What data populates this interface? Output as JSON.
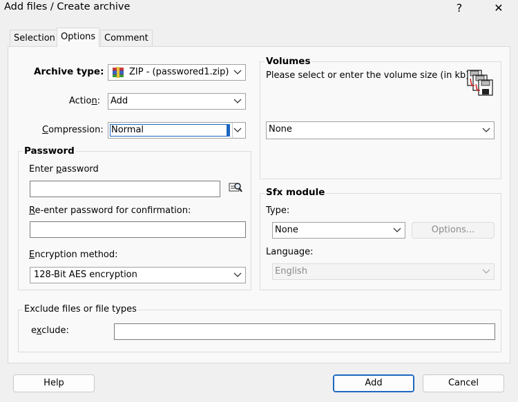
{
  "window": {
    "title": "Add files / Create archive",
    "help_glyph": "?",
    "close_glyph": "✕"
  },
  "tabs": [
    {
      "label": "Selection",
      "active": false
    },
    {
      "label": "Options",
      "active": true
    },
    {
      "label": "Comment",
      "active": false
    }
  ],
  "archive": {
    "type_label": "Archive type:",
    "type_value": "ZIP - (passwored1.zip)",
    "action_label_a": "Actio",
    "action_label_u": "n",
    "action_label_b": ":",
    "action_value": "Add",
    "compression_label_u": "C",
    "compression_label_b": "ompression:",
    "compression_value": "Normal"
  },
  "password": {
    "group_label": "Password",
    "enter_label_a": "Enter ",
    "enter_label_u": "p",
    "enter_label_b": "assword",
    "enter_value": "",
    "reenter_label_u": "R",
    "reenter_label_b": "e-enter password for confirmation:",
    "reenter_value": "",
    "encryption_label_u": "E",
    "encryption_label_b": "ncryption method:",
    "encryption_value": "128-Bit AES encryption"
  },
  "volumes": {
    "group_label": "Volumes",
    "hint": "Please select or enter the volume size (in kb)",
    "value": "None"
  },
  "sfx": {
    "group_label": "Sfx module",
    "type_label": "Type:",
    "type_value": "None",
    "options_button": "Options...",
    "language_label": "Language:",
    "language_value": "English"
  },
  "exclude": {
    "group_label": "Exclude files or file types",
    "field_label_a": "e",
    "field_label_u": "x",
    "field_label_b": "clude:",
    "value": ""
  },
  "buttons": {
    "help": "Help",
    "add": "Add",
    "cancel": "Cancel"
  },
  "colors": {
    "accent": "#1a67c0",
    "panel_bg": "#f9f9f9",
    "window_bg": "#f0f0f0"
  }
}
